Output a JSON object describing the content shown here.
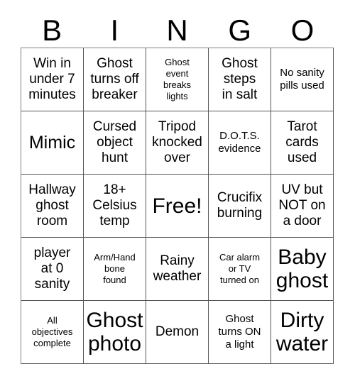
{
  "card": {
    "title": "BINGO",
    "background_color": "#ffffff",
    "text_color": "#000000",
    "grid_line_color": "#555555",
    "columns": 5,
    "rows": 5
  },
  "header": {
    "letters": [
      "B",
      "I",
      "N",
      "G",
      "O"
    ]
  },
  "grid": {
    "cells": [
      {
        "text": "Win in\nunder 7\nminutes",
        "size": "md",
        "free": false
      },
      {
        "text": "Ghost\nturns off\nbreaker",
        "size": "md",
        "free": false
      },
      {
        "text": "Ghost\nevent\nbreaks\nlights",
        "size": "xs",
        "free": false
      },
      {
        "text": "Ghost\nsteps\nin salt",
        "size": "md",
        "free": false
      },
      {
        "text": "No sanity\npills used",
        "size": "sm",
        "free": false
      },
      {
        "text": "Mimic",
        "size": "lg",
        "free": false
      },
      {
        "text": "Cursed\nobject\nhunt",
        "size": "md",
        "free": false
      },
      {
        "text": "Tripod\nknocked\nover",
        "size": "md",
        "free": false
      },
      {
        "text": "D.O.T.S.\nevidence",
        "size": "sm",
        "free": false
      },
      {
        "text": "Tarot\ncards\nused",
        "size": "md",
        "free": false
      },
      {
        "text": "Hallway\nghost\nroom",
        "size": "md",
        "free": false
      },
      {
        "text": "18+\nCelsius\ntemp",
        "size": "md",
        "free": false
      },
      {
        "text": "Free!",
        "size": "xl",
        "free": true
      },
      {
        "text": "Crucifix\nburning",
        "size": "md",
        "free": false
      },
      {
        "text": "UV but\nNOT on\na door",
        "size": "md",
        "free": false
      },
      {
        "text": "player\nat 0\nsanity",
        "size": "md",
        "free": false
      },
      {
        "text": "Arm/Hand\nbone\nfound",
        "size": "xs",
        "free": false
      },
      {
        "text": "Rainy\nweather",
        "size": "md",
        "free": false
      },
      {
        "text": "Car alarm\nor TV\nturned on",
        "size": "xs",
        "free": false
      },
      {
        "text": "Baby\nghost",
        "size": "xl",
        "free": false
      },
      {
        "text": "All\nobjectives\ncomplete",
        "size": "xs",
        "free": false
      },
      {
        "text": "Ghost\nphoto",
        "size": "xl",
        "free": false
      },
      {
        "text": "Demon",
        "size": "md",
        "free": false
      },
      {
        "text": "Ghost\nturns ON\na light",
        "size": "sm",
        "free": false
      },
      {
        "text": "Dirty\nwater",
        "size": "xl",
        "free": false
      }
    ]
  }
}
